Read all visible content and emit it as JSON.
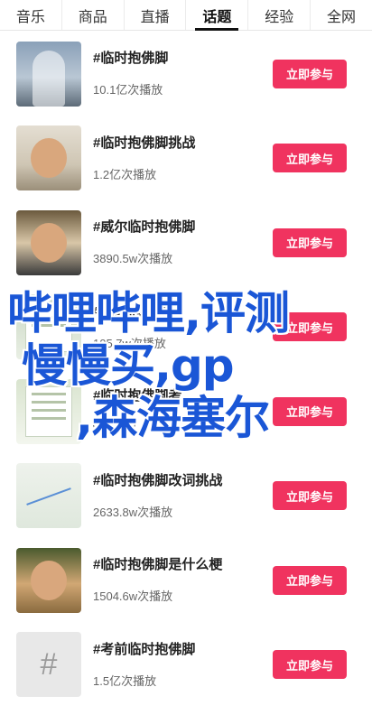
{
  "tabs": [
    {
      "label": "音乐"
    },
    {
      "label": "商品"
    },
    {
      "label": "直播"
    },
    {
      "label": "话题"
    },
    {
      "label": "经验"
    },
    {
      "label": "全网"
    }
  ],
  "active_tab": "话题",
  "topics": [
    {
      "title": "#临时抱佛脚",
      "views": "10.1亿次播放",
      "button": "立即参与"
    },
    {
      "title": "#临时抱佛脚挑战",
      "views": "1.2亿次播放",
      "button": "立即参与"
    },
    {
      "title": "#威尔临时抱佛脚",
      "views": "3890.5w次播放",
      "button": "立即参与"
    },
    {
      "title": "#临时抱佛脚",
      "views": "105.7w次播放",
      "button": "立即参与"
    },
    {
      "title": "#临时抱佛脚考",
      "views": "w次播放",
      "button": "立即参与"
    },
    {
      "title": "#临时抱佛脚改词挑战",
      "views": "2633.8w次播放",
      "button": "立即参与"
    },
    {
      "title": "#临时抱佛脚是什么梗",
      "views": "1504.6w次播放",
      "button": "立即参与"
    },
    {
      "title": "#考前临时抱佛脚",
      "views": "1.5亿次播放",
      "button": "立即参与"
    }
  ],
  "thumb_placeholder_glyph": "#",
  "overlay": {
    "line1": "哔哩哔哩,评测",
    "line2": "慢慢买,gp",
    "line3": ",森海塞尔"
  },
  "colors": {
    "accent": "#f0335f",
    "overlay_text": "#1a56d6"
  }
}
